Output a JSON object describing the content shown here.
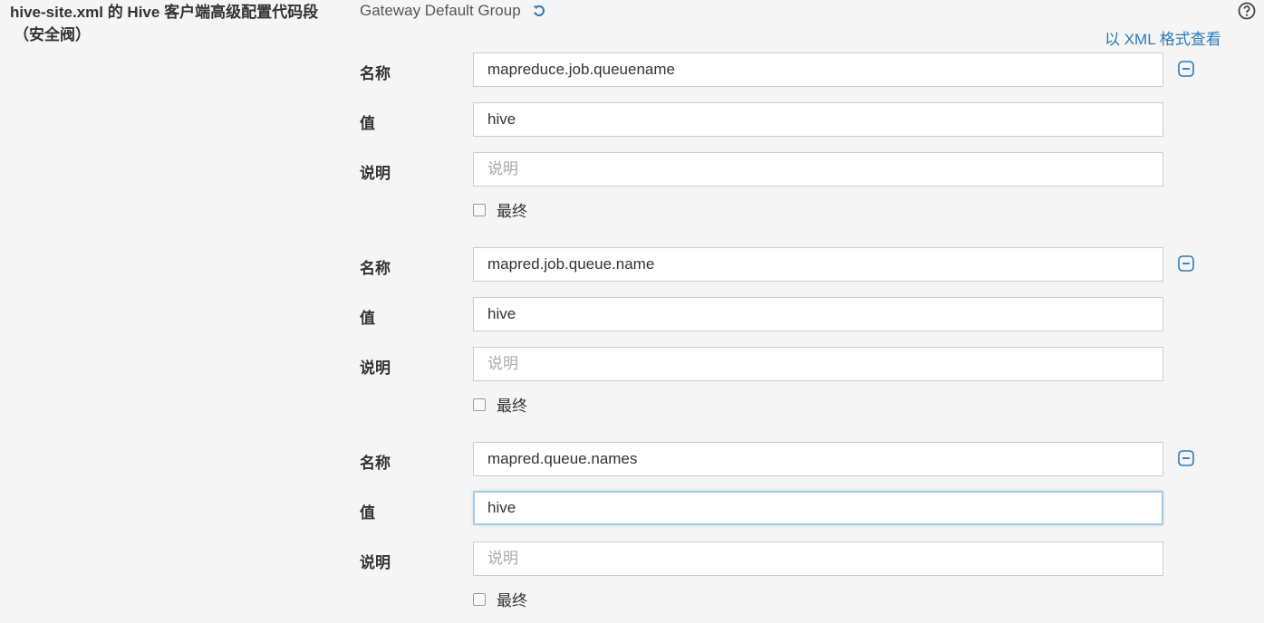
{
  "header": {
    "title_line1": "hive-site.xml 的 Hive 客户端高级配置代码段",
    "title_line2": "（安全阀）",
    "group_name": "Gateway Default Group",
    "xml_link": "以 XML 格式查看",
    "revert_icon": "revert-icon",
    "help_icon": "help-circle-icon"
  },
  "labels": {
    "name": "名称",
    "value": "值",
    "description": "说明",
    "final": "最终",
    "description_placeholder": "说明"
  },
  "entries": [
    {
      "name": "mapreduce.job.queuename",
      "value": "hive",
      "description": "",
      "final": false
    },
    {
      "name": "mapred.job.queue.name",
      "value": "hive",
      "description": "",
      "final": false
    },
    {
      "name": "mapred.queue.names",
      "value": "hive",
      "description": "",
      "final": false
    }
  ],
  "colors": {
    "link": "#2a7ab9",
    "focus_border": "#a9c9df",
    "background": "#f5f5f5"
  }
}
